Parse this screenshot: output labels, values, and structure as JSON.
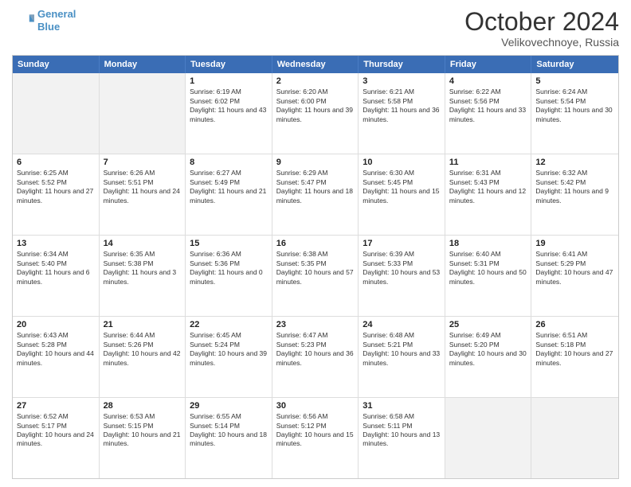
{
  "header": {
    "logo_line1": "General",
    "logo_line2": "Blue",
    "month": "October 2024",
    "location": "Velikovechnoye, Russia"
  },
  "weekdays": [
    "Sunday",
    "Monday",
    "Tuesday",
    "Wednesday",
    "Thursday",
    "Friday",
    "Saturday"
  ],
  "rows": [
    [
      {
        "day": "",
        "text": ""
      },
      {
        "day": "",
        "text": ""
      },
      {
        "day": "1",
        "text": "Sunrise: 6:19 AM\nSunset: 6:02 PM\nDaylight: 11 hours and 43 minutes."
      },
      {
        "day": "2",
        "text": "Sunrise: 6:20 AM\nSunset: 6:00 PM\nDaylight: 11 hours and 39 minutes."
      },
      {
        "day": "3",
        "text": "Sunrise: 6:21 AM\nSunset: 5:58 PM\nDaylight: 11 hours and 36 minutes."
      },
      {
        "day": "4",
        "text": "Sunrise: 6:22 AM\nSunset: 5:56 PM\nDaylight: 11 hours and 33 minutes."
      },
      {
        "day": "5",
        "text": "Sunrise: 6:24 AM\nSunset: 5:54 PM\nDaylight: 11 hours and 30 minutes."
      }
    ],
    [
      {
        "day": "6",
        "text": "Sunrise: 6:25 AM\nSunset: 5:52 PM\nDaylight: 11 hours and 27 minutes."
      },
      {
        "day": "7",
        "text": "Sunrise: 6:26 AM\nSunset: 5:51 PM\nDaylight: 11 hours and 24 minutes."
      },
      {
        "day": "8",
        "text": "Sunrise: 6:27 AM\nSunset: 5:49 PM\nDaylight: 11 hours and 21 minutes."
      },
      {
        "day": "9",
        "text": "Sunrise: 6:29 AM\nSunset: 5:47 PM\nDaylight: 11 hours and 18 minutes."
      },
      {
        "day": "10",
        "text": "Sunrise: 6:30 AM\nSunset: 5:45 PM\nDaylight: 11 hours and 15 minutes."
      },
      {
        "day": "11",
        "text": "Sunrise: 6:31 AM\nSunset: 5:43 PM\nDaylight: 11 hours and 12 minutes."
      },
      {
        "day": "12",
        "text": "Sunrise: 6:32 AM\nSunset: 5:42 PM\nDaylight: 11 hours and 9 minutes."
      }
    ],
    [
      {
        "day": "13",
        "text": "Sunrise: 6:34 AM\nSunset: 5:40 PM\nDaylight: 11 hours and 6 minutes."
      },
      {
        "day": "14",
        "text": "Sunrise: 6:35 AM\nSunset: 5:38 PM\nDaylight: 11 hours and 3 minutes."
      },
      {
        "day": "15",
        "text": "Sunrise: 6:36 AM\nSunset: 5:36 PM\nDaylight: 11 hours and 0 minutes."
      },
      {
        "day": "16",
        "text": "Sunrise: 6:38 AM\nSunset: 5:35 PM\nDaylight: 10 hours and 57 minutes."
      },
      {
        "day": "17",
        "text": "Sunrise: 6:39 AM\nSunset: 5:33 PM\nDaylight: 10 hours and 53 minutes."
      },
      {
        "day": "18",
        "text": "Sunrise: 6:40 AM\nSunset: 5:31 PM\nDaylight: 10 hours and 50 minutes."
      },
      {
        "day": "19",
        "text": "Sunrise: 6:41 AM\nSunset: 5:29 PM\nDaylight: 10 hours and 47 minutes."
      }
    ],
    [
      {
        "day": "20",
        "text": "Sunrise: 6:43 AM\nSunset: 5:28 PM\nDaylight: 10 hours and 44 minutes."
      },
      {
        "day": "21",
        "text": "Sunrise: 6:44 AM\nSunset: 5:26 PM\nDaylight: 10 hours and 42 minutes."
      },
      {
        "day": "22",
        "text": "Sunrise: 6:45 AM\nSunset: 5:24 PM\nDaylight: 10 hours and 39 minutes."
      },
      {
        "day": "23",
        "text": "Sunrise: 6:47 AM\nSunset: 5:23 PM\nDaylight: 10 hours and 36 minutes."
      },
      {
        "day": "24",
        "text": "Sunrise: 6:48 AM\nSunset: 5:21 PM\nDaylight: 10 hours and 33 minutes."
      },
      {
        "day": "25",
        "text": "Sunrise: 6:49 AM\nSunset: 5:20 PM\nDaylight: 10 hours and 30 minutes."
      },
      {
        "day": "26",
        "text": "Sunrise: 6:51 AM\nSunset: 5:18 PM\nDaylight: 10 hours and 27 minutes."
      }
    ],
    [
      {
        "day": "27",
        "text": "Sunrise: 6:52 AM\nSunset: 5:17 PM\nDaylight: 10 hours and 24 minutes."
      },
      {
        "day": "28",
        "text": "Sunrise: 6:53 AM\nSunset: 5:15 PM\nDaylight: 10 hours and 21 minutes."
      },
      {
        "day": "29",
        "text": "Sunrise: 6:55 AM\nSunset: 5:14 PM\nDaylight: 10 hours and 18 minutes."
      },
      {
        "day": "30",
        "text": "Sunrise: 6:56 AM\nSunset: 5:12 PM\nDaylight: 10 hours and 15 minutes."
      },
      {
        "day": "31",
        "text": "Sunrise: 6:58 AM\nSunset: 5:11 PM\nDaylight: 10 hours and 13 minutes."
      },
      {
        "day": "",
        "text": ""
      },
      {
        "day": "",
        "text": ""
      }
    ]
  ]
}
